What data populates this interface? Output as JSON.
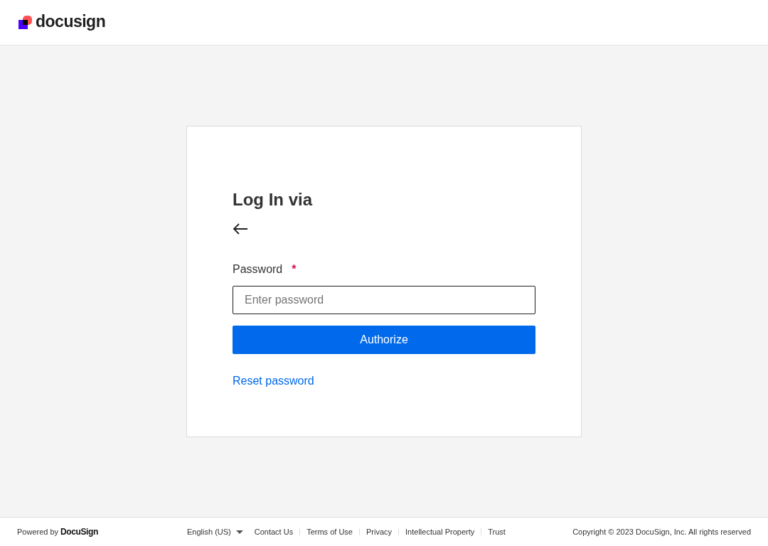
{
  "header": {
    "logo": "docusign"
  },
  "login": {
    "title": "Log In via",
    "password_label": "Password",
    "required_mark": "*",
    "password_placeholder": "Enter password",
    "submit": "Authorize",
    "reset_link": "Reset password"
  },
  "footer": {
    "powered_by": "Powered by",
    "brand": "DocuSign",
    "language": "English (US)",
    "links": [
      "Contact Us",
      "Terms of Use",
      "Privacy",
      "Intellectual Property",
      "Trust"
    ],
    "copyright": "Copyright © 2023 DocuSign, Inc. All rights reserved"
  }
}
